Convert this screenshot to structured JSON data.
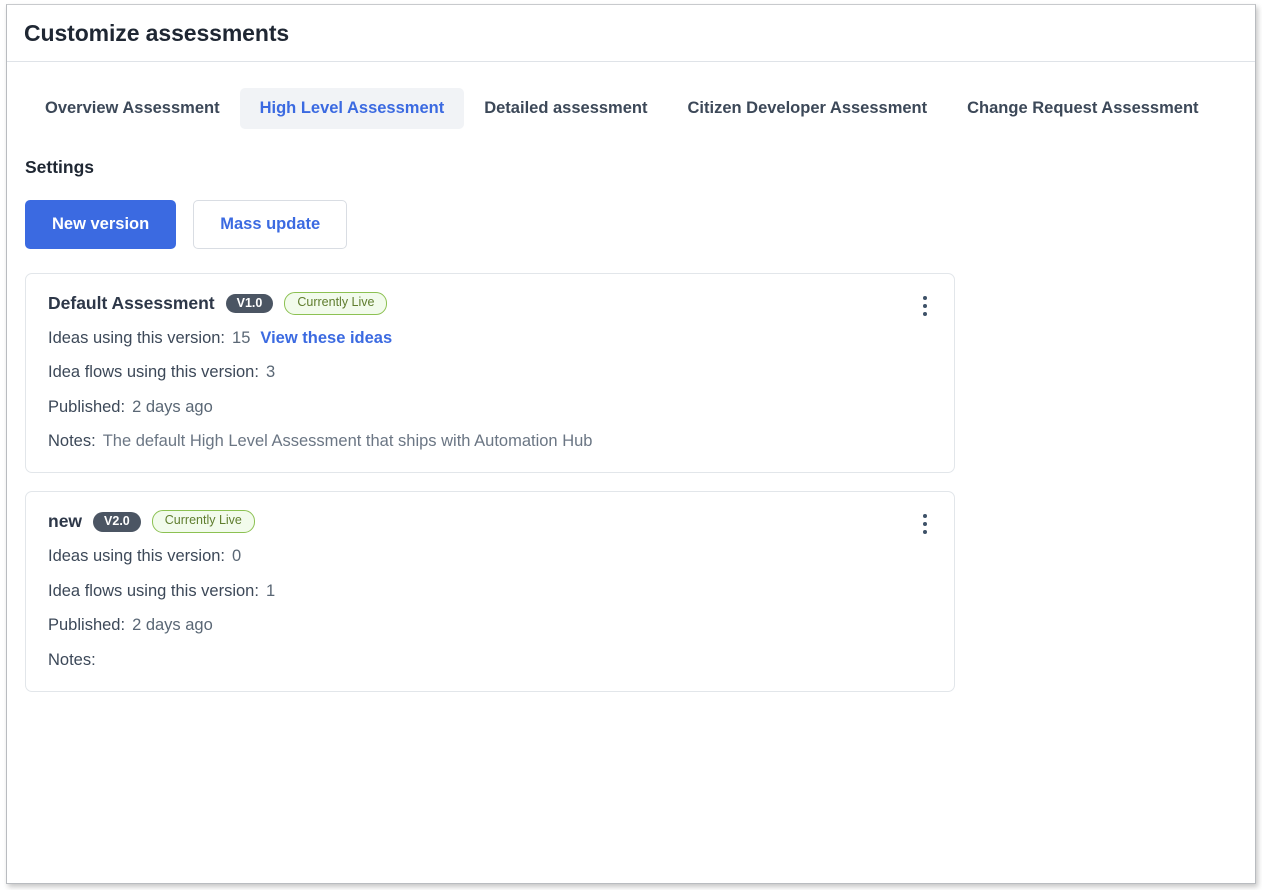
{
  "window": {
    "title": "Customize assessments"
  },
  "tabs": [
    {
      "label": "Overview Assessment",
      "active": false
    },
    {
      "label": "High Level Assessment",
      "active": true
    },
    {
      "label": "Detailed assessment",
      "active": false
    },
    {
      "label": "Citizen Developer Assessment",
      "active": false
    },
    {
      "label": "Change Request Assessment",
      "active": false
    }
  ],
  "settings": {
    "heading": "Settings",
    "new_version_label": "New version",
    "mass_update_label": "Mass update"
  },
  "labels": {
    "ideas_using": "Ideas using this version:",
    "idea_flows_using": "Idea flows using this version:",
    "published": "Published:",
    "notes": "Notes:",
    "view_ideas_link": "View these ideas",
    "kebab_menu": "More options"
  },
  "versions": [
    {
      "name": "Default Assessment",
      "version_badge": "V1.0",
      "status_badge": "Currently Live",
      "ideas_count": "15",
      "has_view_ideas_link": true,
      "idea_flows_count": "3",
      "published": "2 days ago",
      "notes": "The default High Level Assessment that ships with Automation Hub"
    },
    {
      "name": "new",
      "version_badge": "V2.0",
      "status_badge": "Currently Live",
      "ideas_count": "0",
      "has_view_ideas_link": false,
      "idea_flows_count": "1",
      "published": "2 days ago",
      "notes": ""
    }
  ],
  "colors": {
    "accent_blue": "#3b6ae1",
    "badge_gray": "#4b5563",
    "badge_green_text": "#5f7d2e",
    "badge_green_border": "#8cc152",
    "badge_green_bg": "#f2fbec",
    "text_dark": "#1f2733",
    "text_body": "#3c4858",
    "text_muted": "#5a6775",
    "card_border": "#e2e6ea",
    "tab_active_bg": "#f1f3f6"
  }
}
